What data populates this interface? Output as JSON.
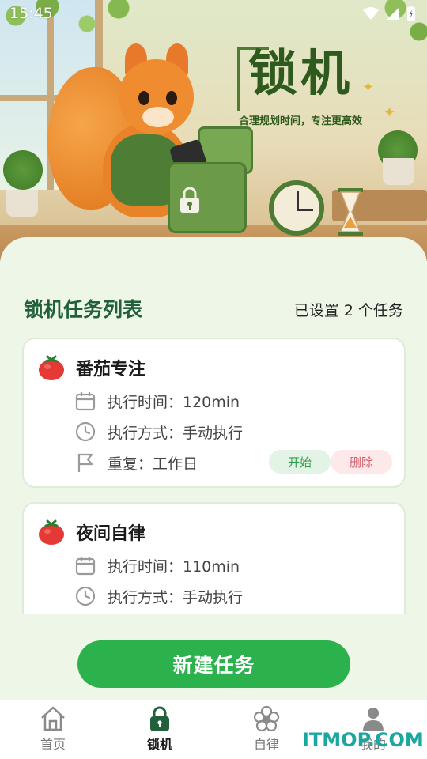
{
  "status_bar": {
    "time": "15:45"
  },
  "hero": {
    "title": "锁机",
    "subtitle": "合理规划时间，专注更高效"
  },
  "section": {
    "title": "锁机任务列表",
    "count_text": "已设置 2 个任务"
  },
  "tasks": [
    {
      "name": "番茄专注",
      "exec_time": "执行时间：120min",
      "exec_mode": "执行方式：手动执行",
      "repeat": "重复：工作日",
      "start_label": "开始",
      "delete_label": "删除"
    },
    {
      "name": "夜间自律",
      "exec_time": "执行时间：110min",
      "exec_mode": "执行方式：手动执行"
    }
  ],
  "new_task_button": "新建任务",
  "nav": [
    {
      "label": "首页",
      "icon": "home-icon",
      "active": false
    },
    {
      "label": "锁机",
      "icon": "lock-icon",
      "active": true
    },
    {
      "label": "自律",
      "icon": "flower-icon",
      "active": false
    },
    {
      "label": "我的",
      "icon": "user-icon",
      "active": false
    }
  ],
  "watermark": "ITMOP.COM",
  "colors": {
    "accent": "#2bb24c",
    "title_green": "#21603a",
    "start_text": "#2fa04a",
    "delete_text": "#d25a67",
    "background": "#eef6e7"
  }
}
